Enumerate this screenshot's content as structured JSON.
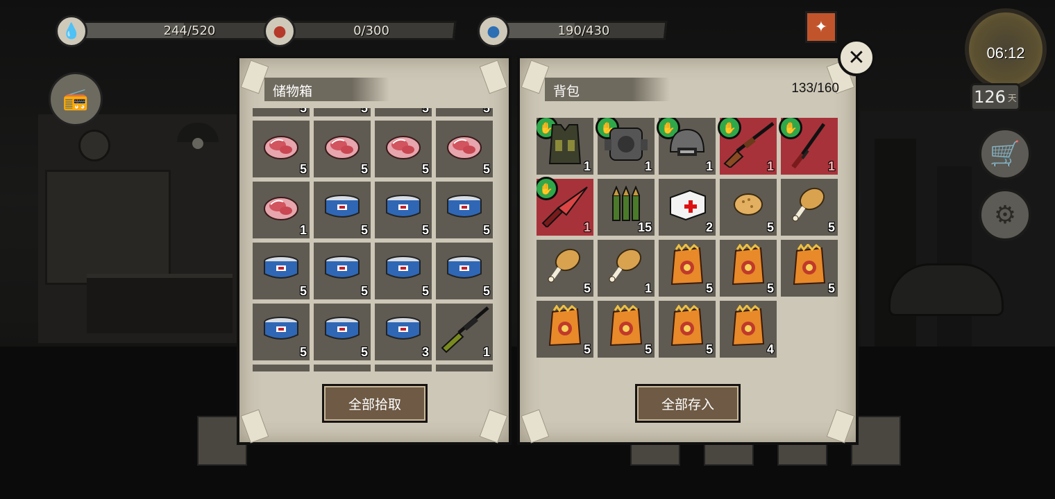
{
  "hud": {
    "health": {
      "value": "244/520",
      "fill": 0.47,
      "icon": "blood-drop-icon"
    },
    "hunger": {
      "value": "0/300",
      "fill": 0.0,
      "icon": "stomach-icon"
    },
    "mind": {
      "value": "190/430",
      "fill": 0.44,
      "icon": "brain-icon"
    },
    "time": "06:12",
    "day_count": "126",
    "day_unit": "天"
  },
  "storage": {
    "title": "储物箱",
    "top_row_qty": [
      "5",
      "5",
      "5",
      "5"
    ],
    "items": [
      {
        "icon": "raw-meat-icon",
        "qty": "5"
      },
      {
        "icon": "raw-meat-icon",
        "qty": "5"
      },
      {
        "icon": "raw-meat-icon",
        "qty": "5"
      },
      {
        "icon": "raw-meat-icon",
        "qty": "5"
      },
      {
        "icon": "raw-meat-icon",
        "qty": "1"
      },
      {
        "icon": "canned-food-icon",
        "qty": "5"
      },
      {
        "icon": "canned-food-icon",
        "qty": "5"
      },
      {
        "icon": "canned-food-icon",
        "qty": "5"
      },
      {
        "icon": "canned-food-icon",
        "qty": "5"
      },
      {
        "icon": "canned-food-icon",
        "qty": "5"
      },
      {
        "icon": "canned-food-icon",
        "qty": "5"
      },
      {
        "icon": "canned-food-icon",
        "qty": "5"
      },
      {
        "icon": "canned-food-icon",
        "qty": "5"
      },
      {
        "icon": "canned-food-icon",
        "qty": "5"
      },
      {
        "icon": "canned-food-icon",
        "qty": "3"
      },
      {
        "icon": "sniper-rifle-icon",
        "qty": "1"
      }
    ],
    "button": "全部拾取"
  },
  "backpack": {
    "title": "背包",
    "capacity": "133/160",
    "items": [
      {
        "icon": "tactical-vest-icon",
        "qty": "1",
        "equipped": true,
        "damaged": false
      },
      {
        "icon": "armored-backpack-icon",
        "qty": "1",
        "equipped": true,
        "damaged": false
      },
      {
        "icon": "combat-helmet-icon",
        "qty": "1",
        "equipped": true,
        "damaged": false
      },
      {
        "icon": "rifle-icon",
        "qty": "1",
        "equipped": true,
        "damaged": true
      },
      {
        "icon": "katana-icon",
        "qty": "1",
        "equipped": true,
        "damaged": true
      },
      {
        "icon": "combat-knife-icon",
        "qty": "1",
        "equipped": true,
        "damaged": true
      },
      {
        "icon": "rifle-ammo-icon",
        "qty": "15",
        "equipped": false,
        "damaged": false
      },
      {
        "icon": "first-aid-kit-icon",
        "qty": "2",
        "equipped": false,
        "damaged": false
      },
      {
        "icon": "biscuit-icon",
        "qty": "5",
        "equipped": false,
        "damaged": false
      },
      {
        "icon": "chicken-leg-icon",
        "qty": "5",
        "equipped": false,
        "damaged": false
      },
      {
        "icon": "chicken-leg-icon",
        "qty": "5",
        "equipped": false,
        "damaged": false
      },
      {
        "icon": "chicken-leg-icon",
        "qty": "1",
        "equipped": false,
        "damaged": false
      },
      {
        "icon": "chips-bag-icon",
        "qty": "5",
        "equipped": false,
        "damaged": false
      },
      {
        "icon": "chips-bag-icon",
        "qty": "5",
        "equipped": false,
        "damaged": false
      },
      {
        "icon": "chips-bag-icon",
        "qty": "5",
        "equipped": false,
        "damaged": false
      },
      {
        "icon": "chips-bag-icon",
        "qty": "5",
        "equipped": false,
        "damaged": false
      },
      {
        "icon": "chips-bag-icon",
        "qty": "5",
        "equipped": false,
        "damaged": false
      },
      {
        "icon": "chips-bag-icon",
        "qty": "5",
        "equipped": false,
        "damaged": false
      },
      {
        "icon": "chips-bag-icon",
        "qty": "4",
        "equipped": false,
        "damaged": false
      }
    ],
    "button": "全部存入"
  },
  "colors": {
    "panel": "#cdc7b7",
    "slot": "#5f5b52",
    "damaged_slot": "#a8323a",
    "equip_badge": "#2fa84a",
    "button": "#6e5a45"
  }
}
